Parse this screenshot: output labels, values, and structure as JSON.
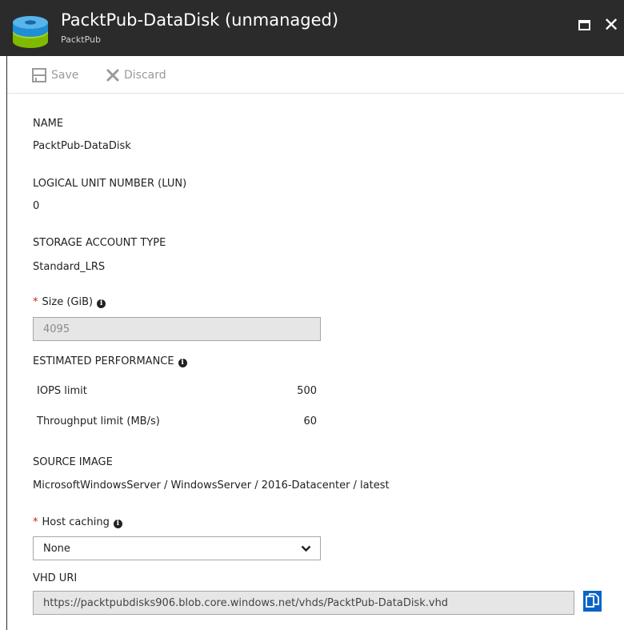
{
  "header": {
    "title": "PacktPub-DataDisk (unmanaged)",
    "subtitle": "PacktPub"
  },
  "toolbar": {
    "save_label": "Save",
    "discard_label": "Discard"
  },
  "fields": {
    "name_label": "NAME",
    "name_value": "PacktPub-DataDisk",
    "lun_label": "LOGICAL UNIT NUMBER (LUN)",
    "lun_value": "0",
    "storage_label": "STORAGE ACCOUNT TYPE",
    "storage_value": "Standard_LRS",
    "size_label": "Size (GiB)",
    "size_value": "4095",
    "perf_label": "ESTIMATED PERFORMANCE",
    "iops_label": "IOPS limit",
    "iops_value": "500",
    "throughput_label": "Throughput limit (MB/s)",
    "throughput_value": "60",
    "source_label": "SOURCE IMAGE",
    "source_value": "MicrosoftWindowsServer / WindowsServer / 2016-Datacenter / latest",
    "caching_label": "Host caching",
    "caching_value": "None",
    "vhd_label": "VHD URI",
    "vhd_value": "https://packtpubdisks906.blob.core.windows.net/vhds/PacktPub-DataDisk.vhd"
  },
  "icons": {
    "disk": "disk-icon",
    "maximize": "maximize-icon",
    "close": "close-icon",
    "save": "save-icon",
    "discard": "discard-icon",
    "info": "info-icon",
    "chevron": "chevron-down-icon",
    "copy": "copy-icon"
  },
  "colors": {
    "titlebar": "#2b2b2b",
    "required": "#d41c1c",
    "accent": "#0a64c8",
    "disabled_text": "#9a9a9a"
  }
}
